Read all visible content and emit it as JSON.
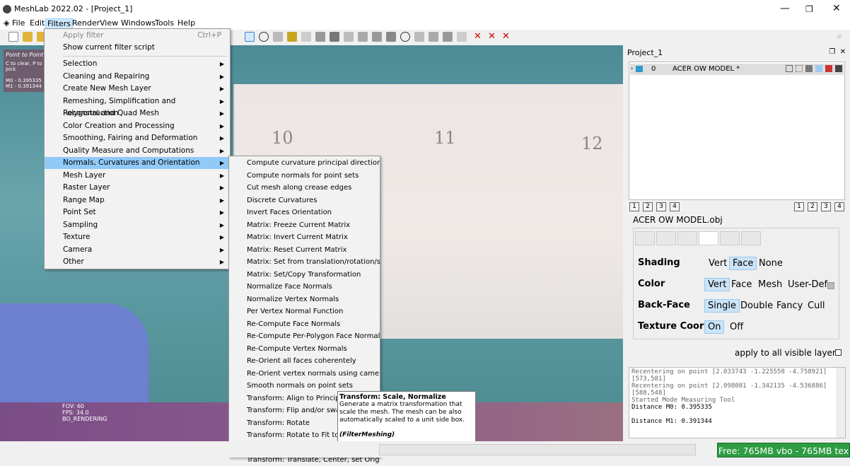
{
  "window": {
    "title": "MeshLab 2022.02 - [Project_1]",
    "minimize": "—",
    "maximize": "❐",
    "close": "✕"
  },
  "menubar": [
    "File",
    "Edit",
    "Filters",
    "Render",
    "View",
    "Windows",
    "Tools",
    "Help"
  ],
  "viewport": {
    "overlay_title": "Point to Point",
    "overlay_hint": "C to clear, P to pick",
    "m0": "M0 - 0.395335",
    "m1": "M1 - 0.391344",
    "fov": "FOV: 60",
    "fps": "FPS:  34.0",
    "rendering": "BO_RENDERING",
    "ruler_numbers": [
      "10",
      "11",
      "12"
    ]
  },
  "filters_menu": {
    "apply_filter": "Apply filter",
    "apply_shortcut": "Ctrl+P",
    "show_script": "Show current filter script",
    "items": [
      "Selection",
      "Cleaning and Repairing",
      "Create New Mesh Layer",
      "Remeshing, Simplification and Reconstruction",
      "Polygonal and Quad Mesh",
      "Color Creation and Processing",
      "Smoothing, Fairing and Deformation",
      "Quality Measure and Computations",
      "Normals, Curvatures and Orientation",
      "Mesh Layer",
      "Raster Layer",
      "Range Map",
      "Point Set",
      "Sampling",
      "Texture",
      "Camera",
      "Other"
    ],
    "highlighted_index": 8
  },
  "submenu": {
    "items": [
      "Compute curvature principal directions",
      "Compute normals for point sets",
      "Cut mesh along crease edges",
      "Discrete Curvatures",
      "Invert Faces Orientation",
      "Matrix: Freeze Current Matrix",
      "Matrix: Invert Current Matrix",
      "Matrix: Reset Current Matrix",
      "Matrix: Set from translation/rotation/scale",
      "Matrix: Set/Copy Transformation",
      "Normalize Face Normals",
      "Normalize Vertex Normals",
      "Per Vertex Normal Function",
      "Re-Compute Face Normals",
      "Re-Compute Per-Polygon Face Normals",
      "Re-Compute Vertex Normals",
      "Re-Orient all faces coherentely",
      "Re-Orient vertex normals using cameras",
      "Smooth normals on point sets",
      "Transform: Align to Principal A",
      "Transform: Flip and/or swap ax",
      "Transform: Rotate",
      "Transform: Rotate to Fit to a pl",
      "Transform: Scale, Normalize",
      "Transform: Translate, Center, set Origin"
    ],
    "highlighted_index": 23
  },
  "tooltip": {
    "title": "Transform: Scale, Normalize",
    "body": "Generate a matrix transformation that scale the mesh. The mesh can be also automatically scaled to a unit side box.",
    "footer": "(FilterMeshing)"
  },
  "project_panel": {
    "title": "Project_1",
    "layer": {
      "index": "0",
      "name": "ACER OW MODEL *"
    },
    "left_nums": [
      "1",
      "2",
      "3",
      "4"
    ],
    "right_nums": [
      "1",
      "2",
      "3",
      "4"
    ],
    "mesh_name": "ACER OW MODEL.obj"
  },
  "render_options": {
    "shading": {
      "label": "Shading",
      "options": [
        "Vert",
        "Face",
        "None"
      ],
      "selected": "Face"
    },
    "color": {
      "label": "Color",
      "options": [
        "Vert",
        "Face",
        "Mesh",
        "User-Def"
      ],
      "selected": "Vert"
    },
    "backface": {
      "label": "Back-Face",
      "options": [
        "Single",
        "Double",
        "Fancy",
        "Cull"
      ],
      "selected": "Single"
    },
    "texture": {
      "label": "Texture Coord",
      "options": [
        "On",
        "Off"
      ],
      "selected": "On"
    },
    "apply_all": "apply to all visible layers"
  },
  "log": [
    {
      "text": "Recentering on point [2.033743 -1.225558 -4.758921]",
      "dim": true
    },
    {
      "text": "[573,581]",
      "dim": true
    },
    {
      "text": "Recentering on point [2.098081 -1.342135 -4.536886]",
      "dim": true
    },
    {
      "text": "[588,548]",
      "dim": true
    },
    {
      "text": "Started Mode Measuring Tool",
      "dim": true
    },
    {
      "text": "Distance M0: 0.395335",
      "dim": false
    },
    {
      "text": "",
      "dim": false
    },
    {
      "text": "Distance M1: 0.391344",
      "dim": false
    }
  ],
  "status": {
    "memory": "Free: 765MB vbo - 765MB tex"
  },
  "colors": {
    "accent": "#91c9f7",
    "memory_bg": "#2e9c42"
  }
}
